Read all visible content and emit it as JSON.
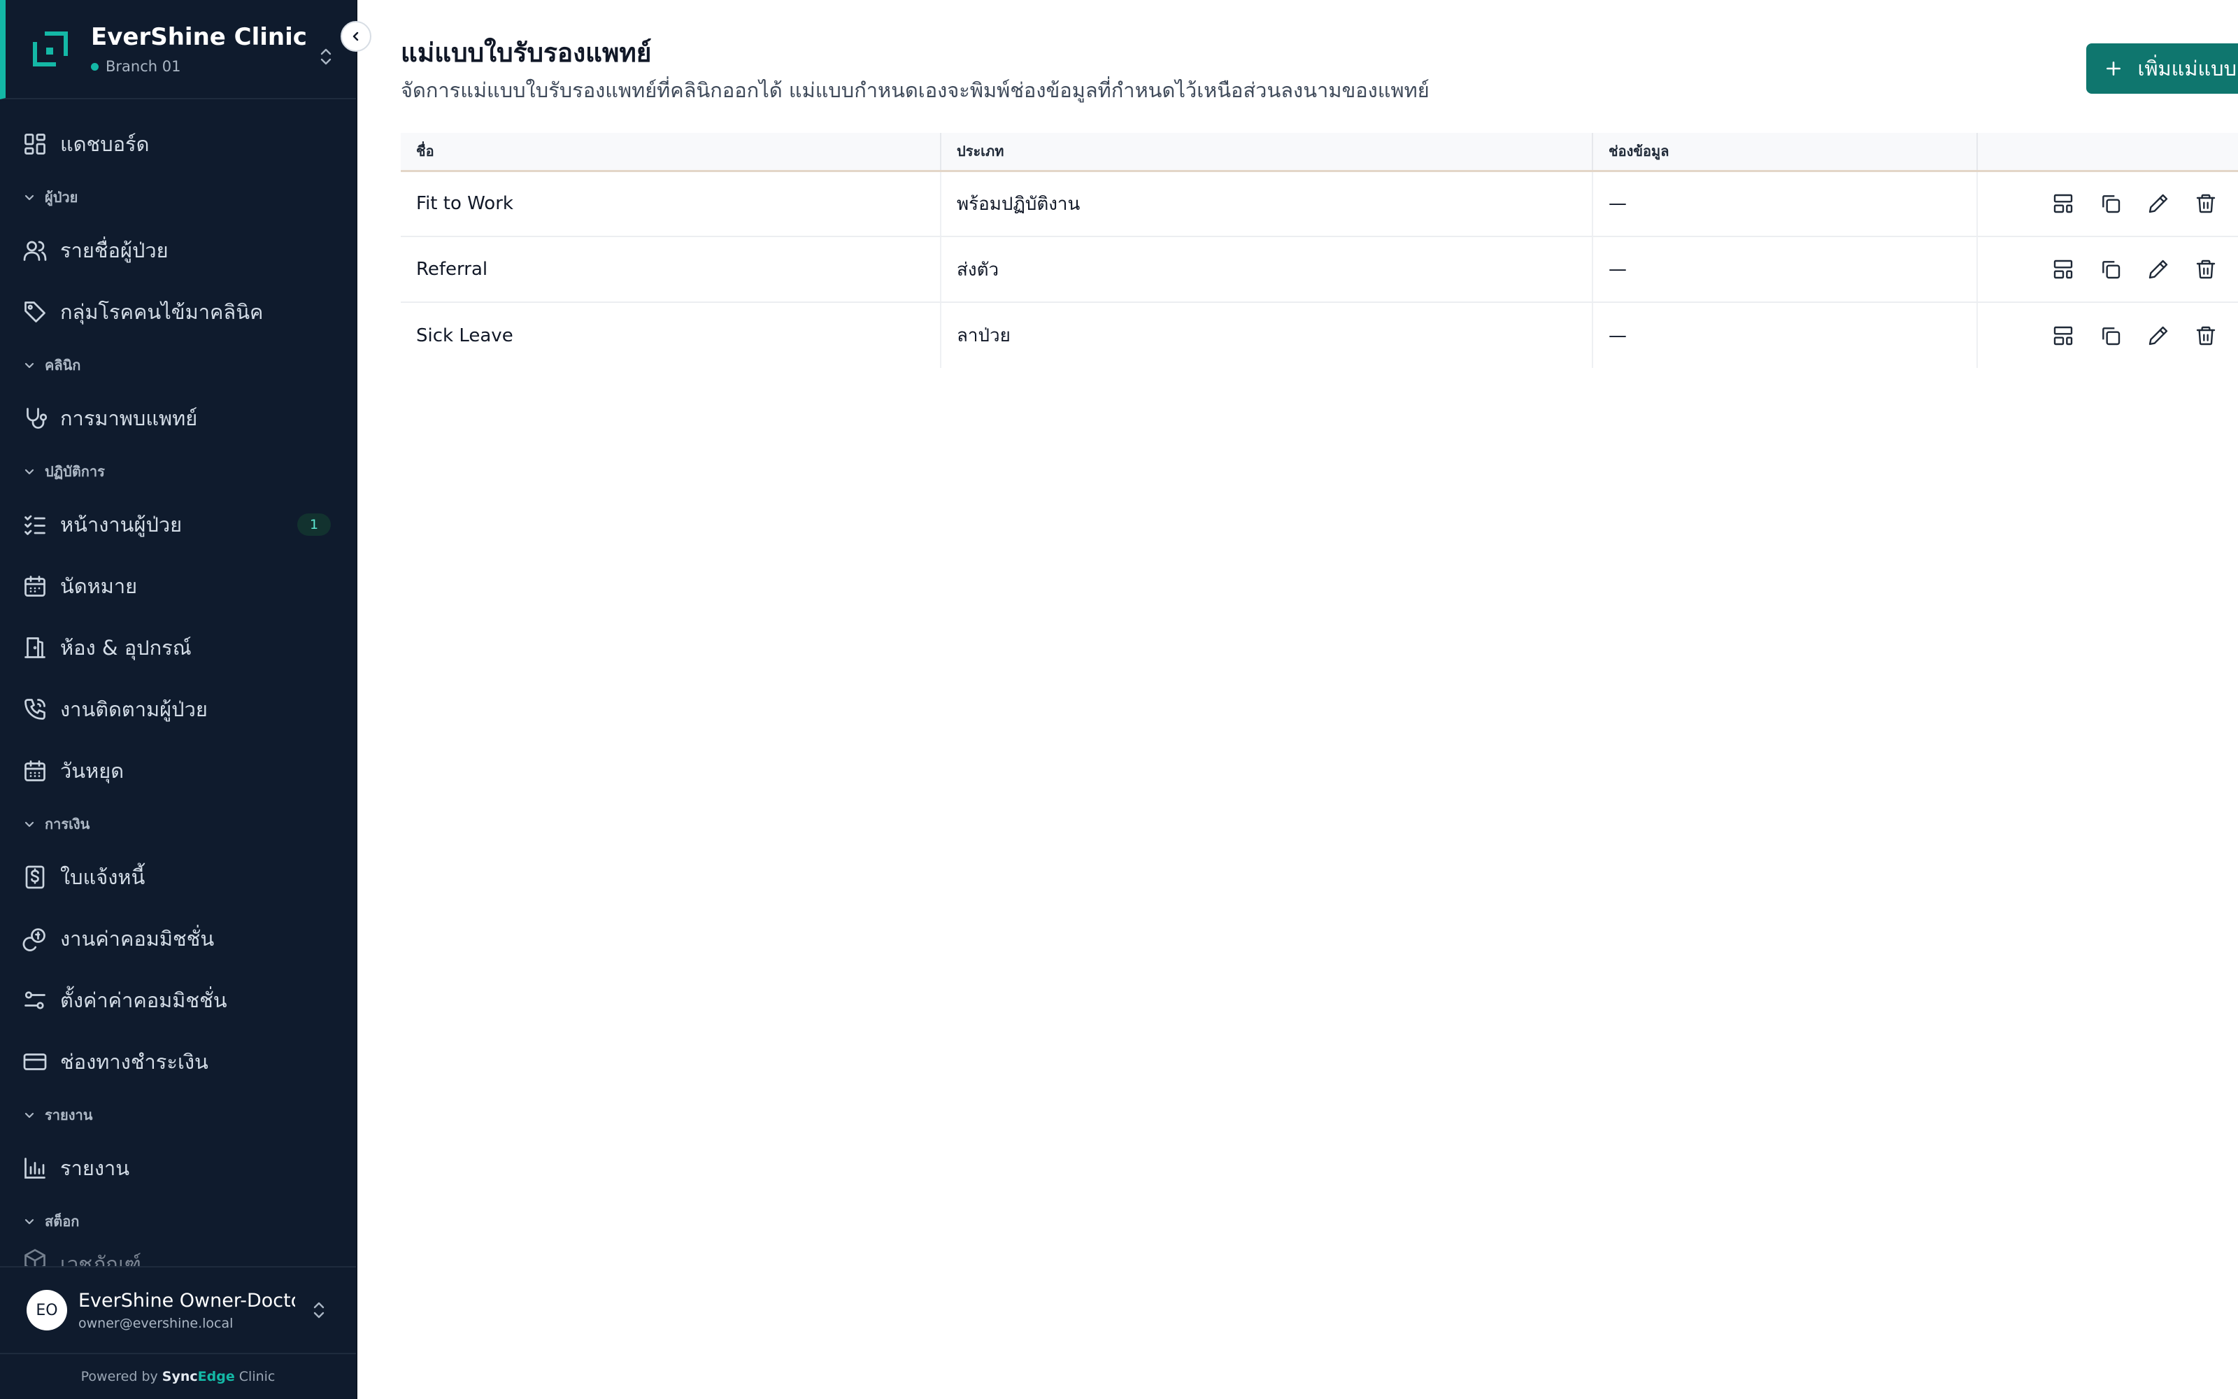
{
  "sidebar": {
    "clinic_name": "EverShine Clinic",
    "branch": "Branch 01",
    "nav": {
      "dashboard": "แดชบอร์ด",
      "patients_section": "ผู้ป่วย",
      "patient_list": "รายชื่อผู้ป่วย",
      "disease_groups": "กลุ่มโรคคนไข้มาคลินิค",
      "clinic_section": "คลินิก",
      "doctor_visits": "การมาพบแพทย์",
      "operations_section": "ปฏิบัติการ",
      "patient_tasks": "หน้างานผู้ป่วย",
      "patient_tasks_badge": "1",
      "appointments": "นัดหมาย",
      "rooms_equipment": "ห้อง & อุปกรณ์",
      "patient_followup": "งานติดตามผู้ป่วย",
      "holidays": "วันหยุด",
      "finance_section": "การเงิน",
      "invoices": "ใบแจ้งหนี้",
      "commission_jobs": "งานค่าคอมมิชชั่น",
      "commission_settings": "ตั้งค่าค่าคอมมิชชั่น",
      "payment_channels": "ช่องทางชำระเงิน",
      "reports_section": "รายงาน",
      "reports": "รายงาน",
      "stock_section": "สต็อก",
      "stock_item_partial": "เวชภัณฑ์"
    },
    "user": {
      "initials": "EO",
      "name": "EverShine Owner-Doctor",
      "email": "owner@evershine.local"
    },
    "powered": {
      "prefix": "Powered by",
      "brand_a": "Sync",
      "brand_b": "Edge",
      "suffix": "Clinic"
    }
  },
  "main": {
    "title": "แม่แบบใบรับรองแพทย์",
    "subtitle": "จัดการแม่แบบใบรับรองแพทย์ที่คลินิกออกได้ แม่แบบกำหนดเองจะพิมพ์ช่องข้อมูลที่กำหนดไว้เหนือส่วนลงนามของแพทย์",
    "add_button": "เพิ่มแม่แบบ",
    "table": {
      "headers": {
        "name": "ชื่อ",
        "type": "ประเภท",
        "fields": "ช่องข้อมูล"
      },
      "rows": [
        {
          "name": "Fit to Work",
          "type": "พร้อมปฏิบัติงาน",
          "fields": "—"
        },
        {
          "name": "Referral",
          "type": "ส่งตัว",
          "fields": "—"
        },
        {
          "name": "Sick Leave",
          "type": "ลาป่วย",
          "fields": "—"
        }
      ]
    }
  },
  "colors": {
    "sidebar_bg": "#0f1b2d",
    "accent": "#14b8a6",
    "primary_button": "#0f766e"
  },
  "icons": {
    "row_actions": [
      "layout-template-icon",
      "copy-icon",
      "pencil-icon",
      "trash-icon"
    ]
  }
}
